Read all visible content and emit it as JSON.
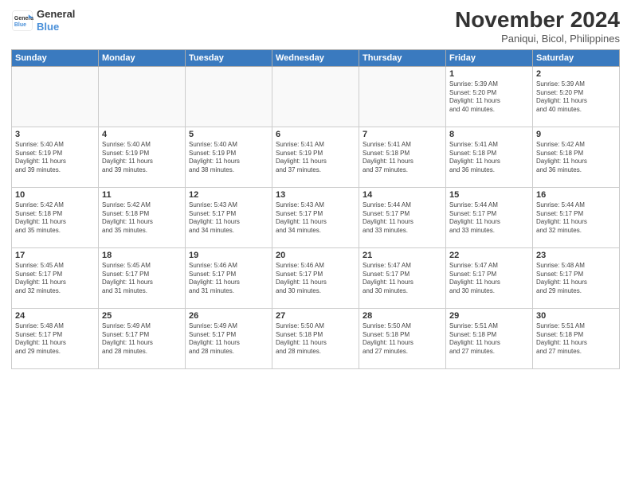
{
  "header": {
    "logo_line1": "General",
    "logo_line2": "Blue",
    "month": "November 2024",
    "location": "Paniqui, Bicol, Philippines"
  },
  "days_of_week": [
    "Sunday",
    "Monday",
    "Tuesday",
    "Wednesday",
    "Thursday",
    "Friday",
    "Saturday"
  ],
  "weeks": [
    [
      {
        "day": "",
        "info": ""
      },
      {
        "day": "",
        "info": ""
      },
      {
        "day": "",
        "info": ""
      },
      {
        "day": "",
        "info": ""
      },
      {
        "day": "",
        "info": ""
      },
      {
        "day": "1",
        "info": "Sunrise: 5:39 AM\nSunset: 5:20 PM\nDaylight: 11 hours\nand 40 minutes."
      },
      {
        "day": "2",
        "info": "Sunrise: 5:39 AM\nSunset: 5:20 PM\nDaylight: 11 hours\nand 40 minutes."
      }
    ],
    [
      {
        "day": "3",
        "info": "Sunrise: 5:40 AM\nSunset: 5:19 PM\nDaylight: 11 hours\nand 39 minutes."
      },
      {
        "day": "4",
        "info": "Sunrise: 5:40 AM\nSunset: 5:19 PM\nDaylight: 11 hours\nand 39 minutes."
      },
      {
        "day": "5",
        "info": "Sunrise: 5:40 AM\nSunset: 5:19 PM\nDaylight: 11 hours\nand 38 minutes."
      },
      {
        "day": "6",
        "info": "Sunrise: 5:41 AM\nSunset: 5:19 PM\nDaylight: 11 hours\nand 37 minutes."
      },
      {
        "day": "7",
        "info": "Sunrise: 5:41 AM\nSunset: 5:18 PM\nDaylight: 11 hours\nand 37 minutes."
      },
      {
        "day": "8",
        "info": "Sunrise: 5:41 AM\nSunset: 5:18 PM\nDaylight: 11 hours\nand 36 minutes."
      },
      {
        "day": "9",
        "info": "Sunrise: 5:42 AM\nSunset: 5:18 PM\nDaylight: 11 hours\nand 36 minutes."
      }
    ],
    [
      {
        "day": "10",
        "info": "Sunrise: 5:42 AM\nSunset: 5:18 PM\nDaylight: 11 hours\nand 35 minutes."
      },
      {
        "day": "11",
        "info": "Sunrise: 5:42 AM\nSunset: 5:18 PM\nDaylight: 11 hours\nand 35 minutes."
      },
      {
        "day": "12",
        "info": "Sunrise: 5:43 AM\nSunset: 5:17 PM\nDaylight: 11 hours\nand 34 minutes."
      },
      {
        "day": "13",
        "info": "Sunrise: 5:43 AM\nSunset: 5:17 PM\nDaylight: 11 hours\nand 34 minutes."
      },
      {
        "day": "14",
        "info": "Sunrise: 5:44 AM\nSunset: 5:17 PM\nDaylight: 11 hours\nand 33 minutes."
      },
      {
        "day": "15",
        "info": "Sunrise: 5:44 AM\nSunset: 5:17 PM\nDaylight: 11 hours\nand 33 minutes."
      },
      {
        "day": "16",
        "info": "Sunrise: 5:44 AM\nSunset: 5:17 PM\nDaylight: 11 hours\nand 32 minutes."
      }
    ],
    [
      {
        "day": "17",
        "info": "Sunrise: 5:45 AM\nSunset: 5:17 PM\nDaylight: 11 hours\nand 32 minutes."
      },
      {
        "day": "18",
        "info": "Sunrise: 5:45 AM\nSunset: 5:17 PM\nDaylight: 11 hours\nand 31 minutes."
      },
      {
        "day": "19",
        "info": "Sunrise: 5:46 AM\nSunset: 5:17 PM\nDaylight: 11 hours\nand 31 minutes."
      },
      {
        "day": "20",
        "info": "Sunrise: 5:46 AM\nSunset: 5:17 PM\nDaylight: 11 hours\nand 30 minutes."
      },
      {
        "day": "21",
        "info": "Sunrise: 5:47 AM\nSunset: 5:17 PM\nDaylight: 11 hours\nand 30 minutes."
      },
      {
        "day": "22",
        "info": "Sunrise: 5:47 AM\nSunset: 5:17 PM\nDaylight: 11 hours\nand 30 minutes."
      },
      {
        "day": "23",
        "info": "Sunrise: 5:48 AM\nSunset: 5:17 PM\nDaylight: 11 hours\nand 29 minutes."
      }
    ],
    [
      {
        "day": "24",
        "info": "Sunrise: 5:48 AM\nSunset: 5:17 PM\nDaylight: 11 hours\nand 29 minutes."
      },
      {
        "day": "25",
        "info": "Sunrise: 5:49 AM\nSunset: 5:17 PM\nDaylight: 11 hours\nand 28 minutes."
      },
      {
        "day": "26",
        "info": "Sunrise: 5:49 AM\nSunset: 5:17 PM\nDaylight: 11 hours\nand 28 minutes."
      },
      {
        "day": "27",
        "info": "Sunrise: 5:50 AM\nSunset: 5:18 PM\nDaylight: 11 hours\nand 28 minutes."
      },
      {
        "day": "28",
        "info": "Sunrise: 5:50 AM\nSunset: 5:18 PM\nDaylight: 11 hours\nand 27 minutes."
      },
      {
        "day": "29",
        "info": "Sunrise: 5:51 AM\nSunset: 5:18 PM\nDaylight: 11 hours\nand 27 minutes."
      },
      {
        "day": "30",
        "info": "Sunrise: 5:51 AM\nSunset: 5:18 PM\nDaylight: 11 hours\nand 27 minutes."
      }
    ]
  ]
}
